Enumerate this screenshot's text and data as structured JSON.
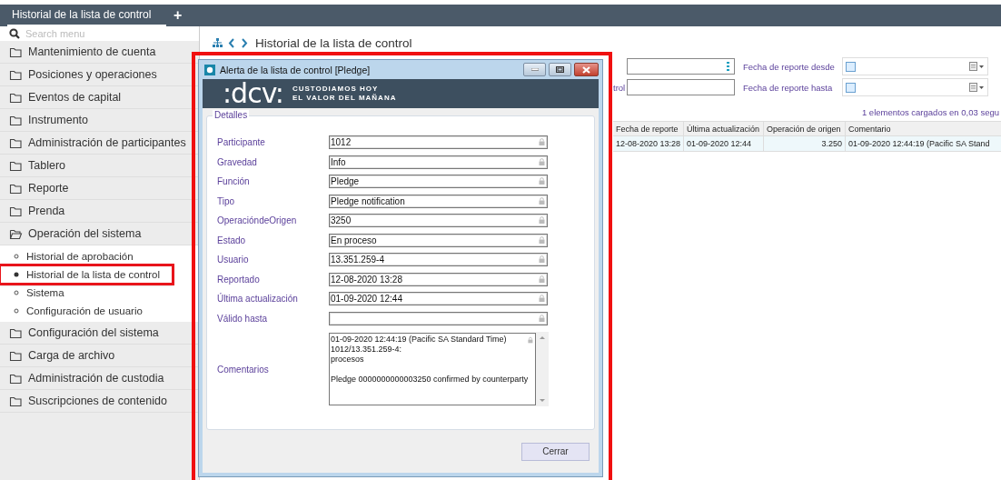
{
  "tabs": [
    {
      "label": "Historial de la lista de control",
      "selected": true
    }
  ],
  "add_tab": "+",
  "sidebar": {
    "search": {
      "placeholder": "Search menu"
    },
    "items": [
      {
        "kind": "folder",
        "label": "Mantenimiento de cuenta"
      },
      {
        "kind": "folder",
        "label": "Posiciones y operaciones"
      },
      {
        "kind": "folder",
        "label": "Eventos de capital"
      },
      {
        "kind": "folder",
        "label": "Instrumento"
      },
      {
        "kind": "folder",
        "label": "Administración de participantes"
      },
      {
        "kind": "folder",
        "label": "Tablero"
      },
      {
        "kind": "folder",
        "label": "Reporte"
      },
      {
        "kind": "folder",
        "label": "Prenda"
      },
      {
        "kind": "open_folder",
        "label": "Operación del sistema",
        "children": [
          {
            "label": "Historial de aprobación",
            "selected": false
          },
          {
            "label": "Historial de la lista de control",
            "selected": true
          },
          {
            "label": "Sistema",
            "selected": false
          },
          {
            "label": "Configuración de usuario",
            "selected": false
          }
        ]
      },
      {
        "kind": "folder",
        "label": "Configuración del sistema"
      },
      {
        "kind": "folder",
        "label": "Carga de archivo"
      },
      {
        "kind": "folder",
        "label": "Administración de custodia"
      },
      {
        "kind": "folder",
        "label": "Suscripciones de contenido"
      }
    ]
  },
  "page": {
    "title": "Historial de la lista de control",
    "filters": [
      {
        "kind": "picker"
      },
      {
        "label": "trol",
        "kind": "text"
      }
    ],
    "date_filters": [
      {
        "label": "Fecha de reporte desde",
        "checked": false
      },
      {
        "label": "Fecha de reporte hasta",
        "checked": false
      }
    ],
    "status": "1 elementos cargados en 0,03 segu",
    "table": {
      "columns": [
        "Fecha de reporte",
        "Última actualización",
        "Operación de origen",
        "Comentario"
      ],
      "rows": [
        [
          "12-08-2020 13:28",
          "01-09-2020 12:44",
          "3.250",
          "01-09-2020 12:44:19 (Pacific SA Stand"
        ]
      ]
    }
  },
  "dialog": {
    "title": "Alerta de la lista de control [Pledge]",
    "logo": {
      "text": ":dcv:",
      "tagline": [
        "CUSTODIAMOS HOY",
        "EL VALOR DEL MAÑANA"
      ]
    },
    "group": "Detalles",
    "fields": [
      {
        "label": "Participante",
        "value": "1012"
      },
      {
        "label": "Gravedad",
        "value": "Info"
      },
      {
        "label": "Función",
        "value": "Pledge"
      },
      {
        "label": "Tipo",
        "value": "Pledge notification"
      },
      {
        "label": "OperacióndeOrigen",
        "value": "3250"
      },
      {
        "label": "Estado",
        "value": "En proceso"
      },
      {
        "label": "Usuario",
        "value": "13.351.259-4"
      },
      {
        "label": "Reportado",
        "value": "12-08-2020 13:28"
      },
      {
        "label": "Última actualización",
        "value": "01-09-2020 12:44"
      },
      {
        "label": "Válido hasta"
      }
    ],
    "comments": {
      "label": "Comentarios",
      "lines": [
        "01-09-2020 12:44:19 (Pacific SA Standard Time)",
        "1012/13.351.259-4:",
        "procesos"
      ],
      "note": "Pledge 0000000000003250 confirmed by counterparty"
    },
    "close_button": "Cerrar"
  }
}
